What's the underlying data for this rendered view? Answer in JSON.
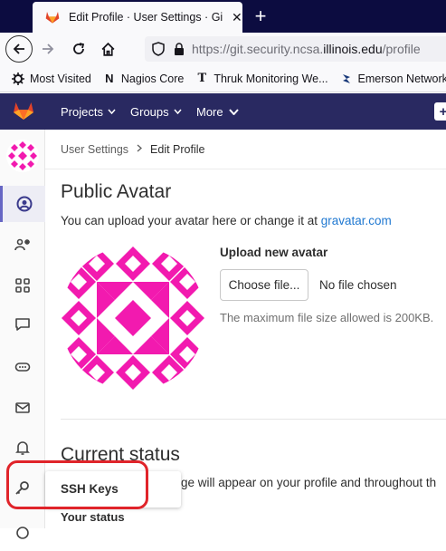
{
  "browser": {
    "tab_title": "Edit Profile · User Settings · GitL",
    "tab_close": "✕",
    "new_tab": "+",
    "url": {
      "prefix": "https://git.security.ncsa.",
      "domain": "illinois.edu",
      "path": "/profile"
    },
    "bookmarks": [
      {
        "label": "Most Visited",
        "icon": "gear-icon"
      },
      {
        "label": "Nagios Core",
        "icon": "nagios-icon"
      },
      {
        "label": "Thruk Monitoring We...",
        "icon": "thruk-icon"
      },
      {
        "label": "Emerson Network P",
        "icon": "emerson-icon"
      }
    ]
  },
  "gitlab": {
    "menu": [
      {
        "label": "Projects"
      },
      {
        "label": "Groups"
      },
      {
        "label": "More"
      }
    ],
    "colors": {
      "header": "#292961",
      "link": "#1f78d1",
      "highlight": "#e0242a",
      "avatar": "#f21aaf"
    }
  },
  "breadcrumb": {
    "parent": "User Settings",
    "current": "Edit Profile"
  },
  "avatar_section": {
    "heading": "Public Avatar",
    "text": "You can upload your avatar here or change it at ",
    "link": "gravatar.com",
    "upload_label": "Upload new avatar",
    "choose_button": "Choose file...",
    "no_file": "No file chosen",
    "max_size": "The maximum file size allowed is 200KB."
  },
  "status_section": {
    "heading": "Current status",
    "text": "ge will appear on your profile and throughout th",
    "your_status": "Your status"
  },
  "sidebar": {
    "flyout_label": "SSH Keys"
  }
}
